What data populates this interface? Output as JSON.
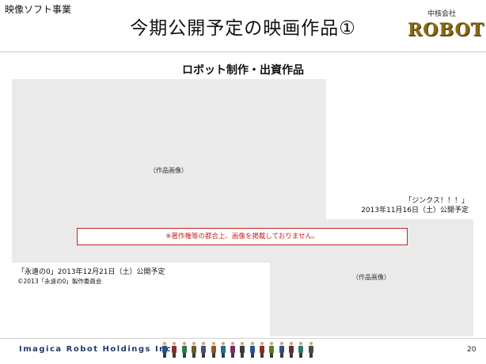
{
  "header": {
    "section_label": "映像ソフト事業",
    "title": "今期公開予定の映画作品①",
    "logo_subtext": "中核会社",
    "logo_text": "ROBOT"
  },
  "main": {
    "subtitle": "ロボット制作・出資作品",
    "posters": [
      {
        "placeholder_label": "（作品画像）",
        "caption_lines": [
          "「永遠の0」2013年12月21日（土）公開予定",
          "©2013「永遠の0」製作委員会"
        ]
      },
      {
        "placeholder_label": "（作品画像）",
        "caption_lines": [
          "「ジンクス！！！」",
          "2013年11月16日（土）公開予定"
        ]
      }
    ],
    "notice": "※著作権等の都合上、画像を掲載しておりません。"
  },
  "footer": {
    "company": "Imagica Robot Holdings Inc.",
    "page_number": "20",
    "people_icons": "person-icon"
  },
  "colors": {
    "notice_red": "#cc2222",
    "placeholder_gray": "#eaeaea",
    "company_blue": "#1f3a6e",
    "logo_gold": "#8a6a10"
  }
}
